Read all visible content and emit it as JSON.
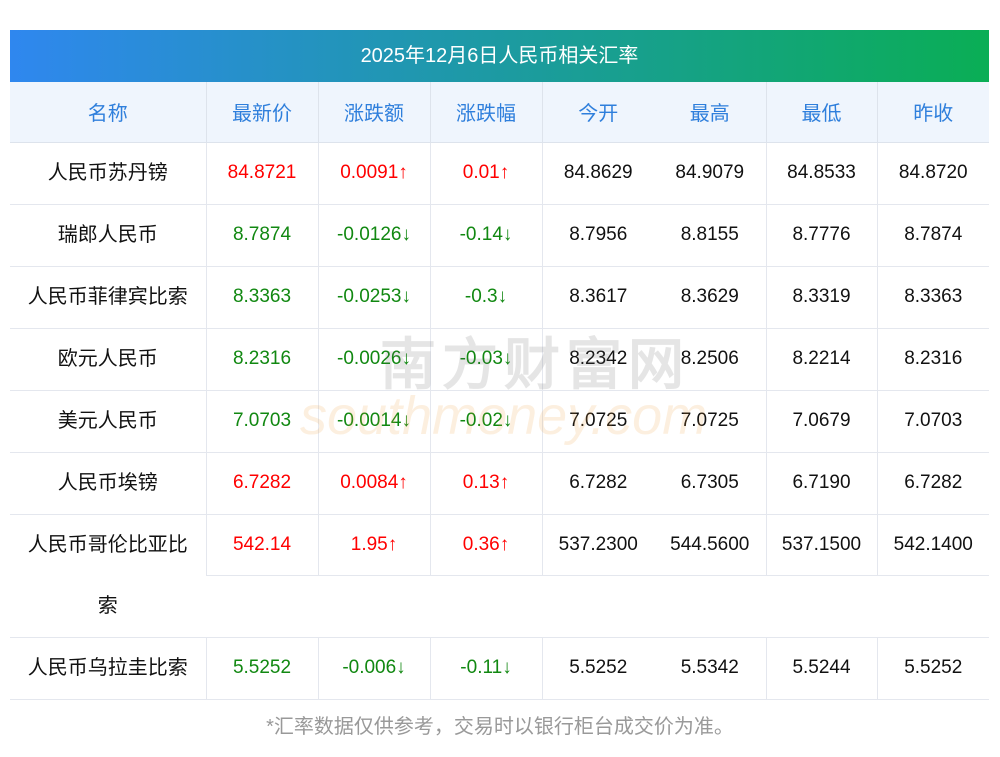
{
  "title": "2025年12月6日人民币相关汇率",
  "headers": [
    "名称",
    "最新价",
    "涨跌额",
    "涨跌幅",
    "今开",
    "最高",
    "最低",
    "昨收"
  ],
  "rows": [
    {
      "name": "人民币苏丹镑",
      "last": "84.8721",
      "chg": "0.0091↑",
      "pct": "0.01↑",
      "open": "84.8629",
      "high": "84.9079",
      "low": "84.8533",
      "prev": "84.8720",
      "dir": "up"
    },
    {
      "name": "瑞郎人民币",
      "last": "8.7874",
      "chg": "-0.0126↓",
      "pct": "-0.14↓",
      "open": "8.7956",
      "high": "8.8155",
      "low": "8.7776",
      "prev": "8.7874",
      "dir": "down"
    },
    {
      "name": "人民币菲律宾比索",
      "last": "8.3363",
      "chg": "-0.0253↓",
      "pct": "-0.3↓",
      "open": "8.3617",
      "high": "8.3629",
      "low": "8.3319",
      "prev": "8.3363",
      "dir": "down"
    },
    {
      "name": "欧元人民币",
      "last": "8.2316",
      "chg": "-0.0026↓",
      "pct": "-0.03↓",
      "open": "8.2342",
      "high": "8.2506",
      "low": "8.2214",
      "prev": "8.2316",
      "dir": "down"
    },
    {
      "name": "美元人民币",
      "last": "7.0703",
      "chg": "-0.0014↓",
      "pct": "-0.02↓",
      "open": "7.0725",
      "high": "7.0725",
      "low": "7.0679",
      "prev": "7.0703",
      "dir": "down"
    },
    {
      "name": "人民币埃镑",
      "last": "6.7282",
      "chg": "0.0084↑",
      "pct": "0.13↑",
      "open": "6.7282",
      "high": "6.7305",
      "low": "6.7190",
      "prev": "6.7282",
      "dir": "up"
    },
    {
      "name": "人民币哥伦比亚比索",
      "last": "542.14",
      "chg": "1.95↑",
      "pct": "0.36↑",
      "open": "537.2300",
      "high": "544.5600",
      "low": "537.1500",
      "prev": "542.1400",
      "dir": "up"
    },
    {
      "name": "人民币乌拉圭比索",
      "last": "5.5252",
      "chg": "-0.006↓",
      "pct": "-0.11↓",
      "open": "5.5252",
      "high": "5.5342",
      "low": "5.5244",
      "prev": "5.5252",
      "dir": "down"
    }
  ],
  "footer": "*汇率数据仅供参考，交易时以银行柜台成交价为准。",
  "watermark": {
    "cn": "南方财富网",
    "en": "southmoney.com"
  },
  "colors": {
    "up": "#ff0000",
    "down": "#118811",
    "header": "#2f7fdc"
  }
}
